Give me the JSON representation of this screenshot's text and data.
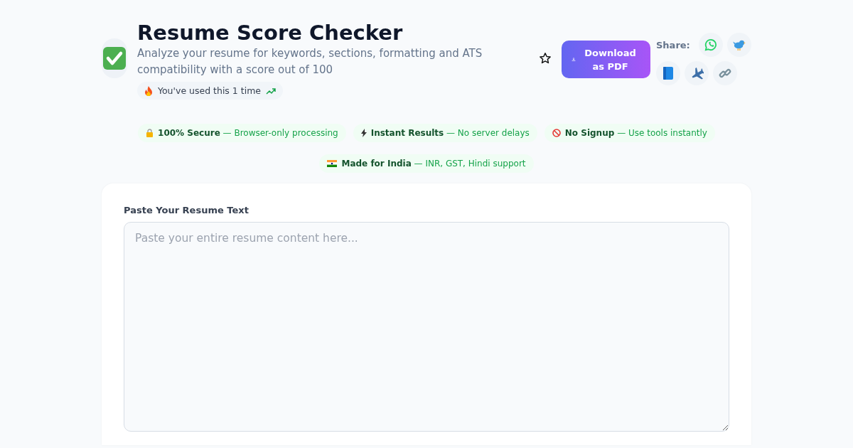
{
  "header": {
    "title": "Resume Score Checker",
    "description": "Analyze your resume for keywords, sections, formatting and ATS compatibility with a score out of 100",
    "usage": "You've used this 1 time"
  },
  "download_button": "Download as PDF",
  "share": {
    "label": "Share:"
  },
  "badges": [
    {
      "kind": "lock",
      "title": "100% Secure",
      "detail": "— Browser-only processing"
    },
    {
      "kind": "bolt",
      "title": "Instant Results",
      "detail": "— No server delays"
    },
    {
      "kind": "no-entry",
      "title": "No Signup",
      "detail": "— Use tools instantly"
    },
    {
      "kind": "flag",
      "title": "Made for India",
      "detail": "— INR, GST, Hindi support"
    }
  ],
  "resume_input": {
    "label": "Paste Your Resume Text",
    "placeholder": "Paste your entire resume content here..."
  }
}
